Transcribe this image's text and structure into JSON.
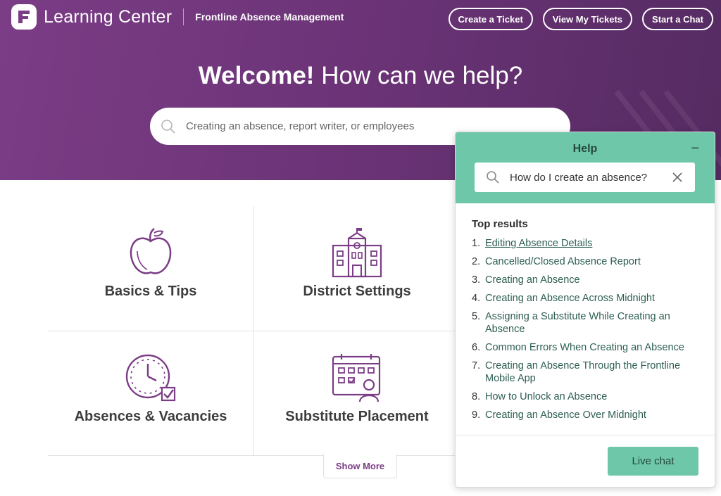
{
  "header": {
    "brand_title": "Learning Center",
    "brand_subtitle": "Frontline Absence Management",
    "actions": [
      "Create a Ticket",
      "View My Tickets",
      "Start a Chat"
    ]
  },
  "hero": {
    "welcome_bold": "Welcome!",
    "welcome_rest": "How can we help?",
    "search_placeholder": "Creating an absence, report writer, or employees"
  },
  "categories": [
    {
      "label": "Basics & Tips",
      "icon": "apple-icon"
    },
    {
      "label": "District Settings",
      "icon": "school-building-icon"
    },
    {
      "label": "Absences & Vacancies",
      "icon": "clock-check-icon"
    },
    {
      "label": "Substitute Placement",
      "icon": "calendar-person-icon"
    }
  ],
  "show_more": "Show More",
  "help": {
    "title": "Help",
    "minimize": "−",
    "search_value": "How do I create an absence?",
    "results_title": "Top results",
    "results": [
      "Editing Absence Details",
      "Cancelled/Closed Absence Report",
      "Creating an Absence",
      "Creating an Absence Across Midnight",
      "Assigning a Substitute While Creating an Absence",
      "Common Errors When Creating an Absence",
      "Creating an Absence Through the Frontline Mobile App",
      "How to Unlock an Absence",
      "Creating an Absence Over Midnight"
    ],
    "result_numbers": [
      "1.",
      "2.",
      "3.",
      "4.",
      "5.",
      "6.",
      "7.",
      "8.",
      "9."
    ],
    "live_chat": "Live chat"
  },
  "colors": {
    "brand_purple": "#7b3d86",
    "help_green": "#6dc7a8",
    "link_green": "#2d5e52"
  }
}
